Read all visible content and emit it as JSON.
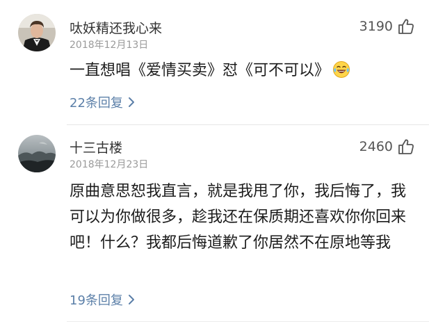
{
  "comments": [
    {
      "username": "呔妖精还我心来",
      "date": "2018年12月13日",
      "likes": "3190",
      "text": "一直想唱《爱情买卖》怼《可不可以》",
      "emoji": "laughing-tears-emoji",
      "replies": "22条回复"
    },
    {
      "username": "十三古楼",
      "date": "2018年12月23日",
      "likes": "2460",
      "text": "原曲意思恕我直言，就是我甩了你，我后悔了，我可以为你做很多，趁我还在保质期还喜欢你你回来吧！什么？我都后悔道歉了你居然不在原地等我",
      "replies": "19条回复"
    }
  ],
  "icons": {
    "like": "thumbs-up-icon",
    "chevron": "chevron-right-icon"
  },
  "colors": {
    "reply_link": "#5b7fa8",
    "meta_gray": "#9a9a9a",
    "text": "#1c1c1c"
  }
}
